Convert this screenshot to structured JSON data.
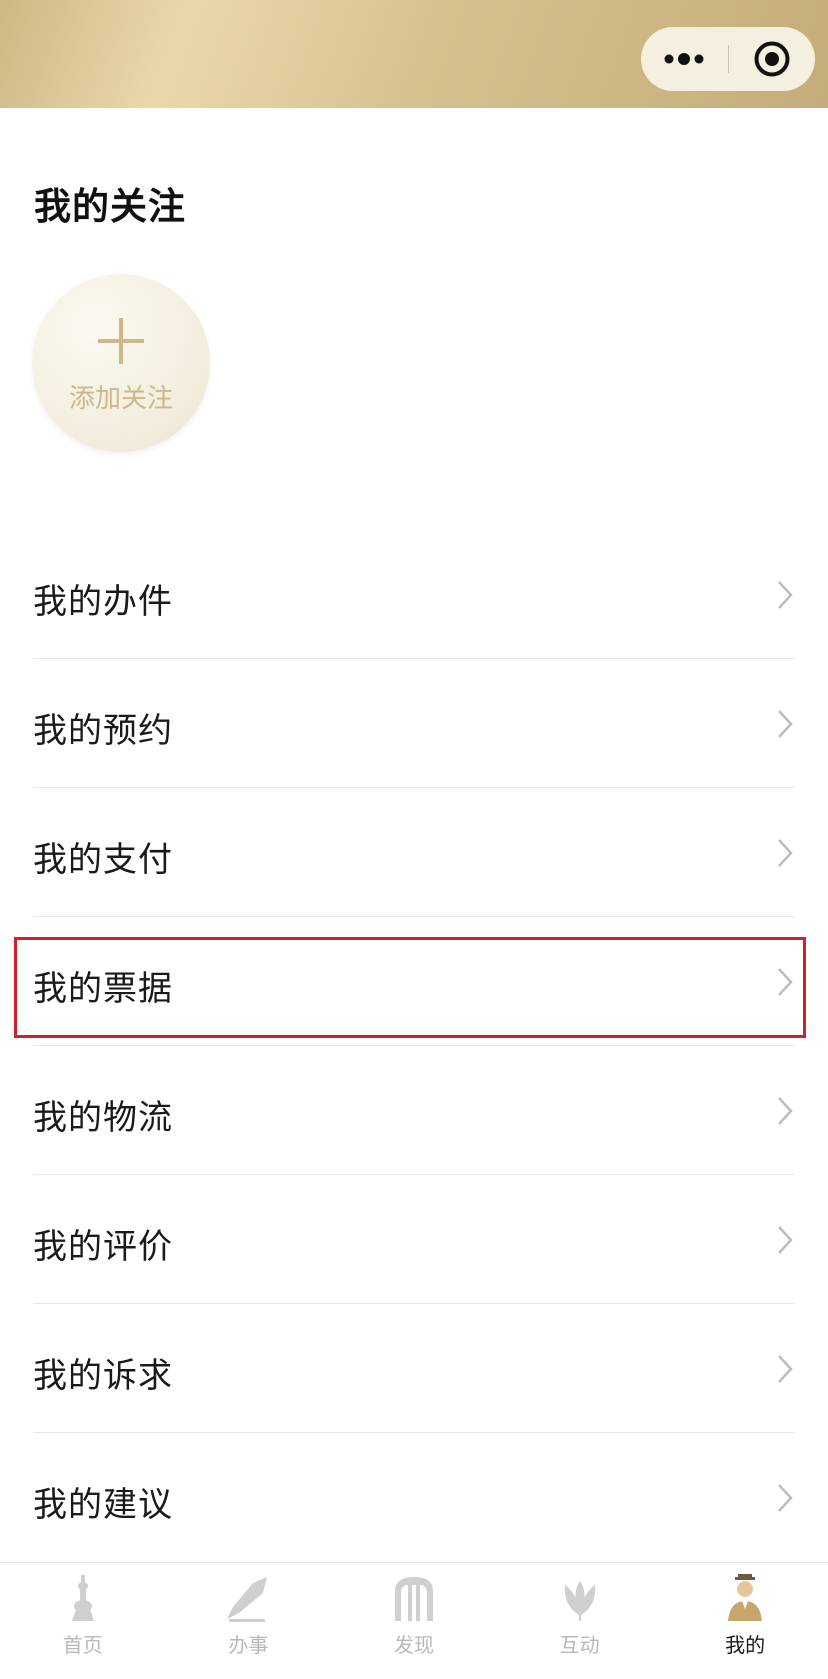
{
  "header": {
    "more_icon": "more-dots-icon",
    "close_icon": "target-close-icon"
  },
  "follow": {
    "title": "我的关注",
    "add_label": "添加关注"
  },
  "menu": {
    "items": [
      {
        "label": "我的办件"
      },
      {
        "label": "我的预约"
      },
      {
        "label": "我的支付"
      },
      {
        "label": "我的票据"
      },
      {
        "label": "我的物流"
      },
      {
        "label": "我的评价"
      },
      {
        "label": "我的诉求"
      },
      {
        "label": "我的建议"
      }
    ]
  },
  "tabbar": {
    "tabs": [
      {
        "label": "首页",
        "icon": "tower-icon",
        "active": false
      },
      {
        "label": "办事",
        "icon": "pen-icon",
        "active": false
      },
      {
        "label": "发现",
        "icon": "arches-icon",
        "active": false
      },
      {
        "label": "互动",
        "icon": "magnolia-icon",
        "active": false
      },
      {
        "label": "我的",
        "icon": "person-icon",
        "active": true
      }
    ]
  },
  "colors": {
    "accent_gold": "#cdb889",
    "highlight_red": "#d0202a",
    "tab_inactive": "#b9b9b9",
    "tab_active": "#1a1a1a"
  }
}
